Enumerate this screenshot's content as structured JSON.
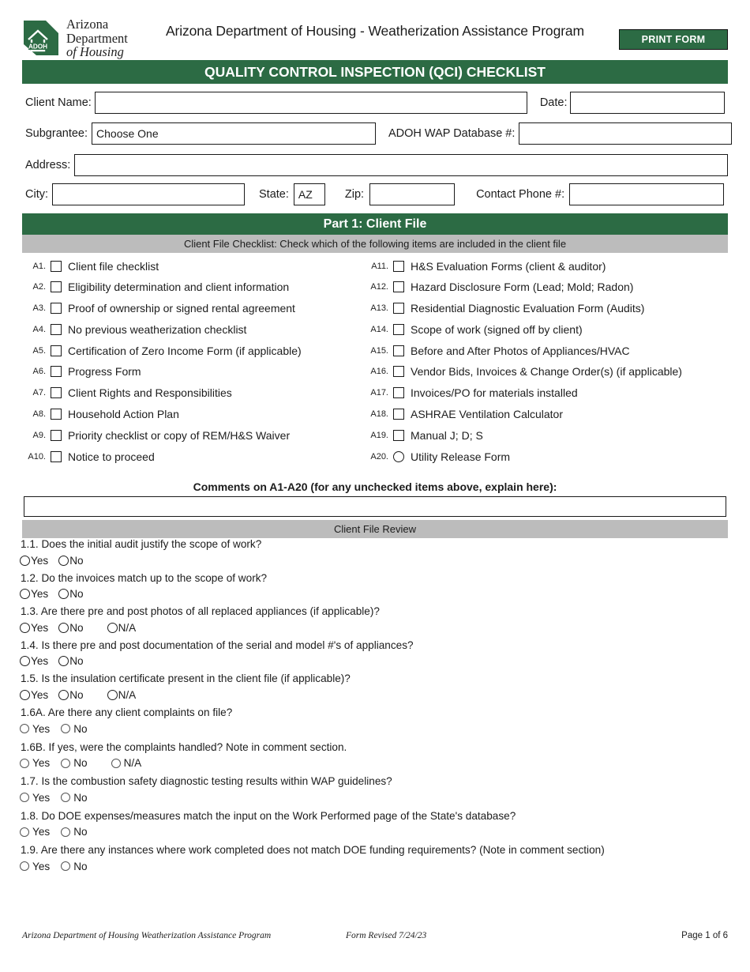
{
  "masthead": {
    "logo_line1": "Arizona",
    "logo_line2": "Department",
    "logo_line3": "of Housing",
    "logo_badge": "ADOH",
    "title": "Arizona Department of Housing - Weatherization Assistance Program",
    "print_button": "PRINT FORM"
  },
  "form_title": "QUALITY CONTROL INSPECTION (QCI) CHECKLIST",
  "fields": {
    "client_name_label": "Client Name:",
    "client_name_value": "",
    "date_label": "Date:",
    "date_value": "",
    "subgrantee_label": "Subgrantee:",
    "subgrantee_value": "Choose One",
    "adoh_db_label": "ADOH WAP Database #:",
    "adoh_db_value": "",
    "address_label": "Address:",
    "address_value": "",
    "city_label": "City:",
    "city_value": "",
    "state_label": "State:",
    "state_value": "AZ",
    "zip_label": "Zip:",
    "zip_value": "",
    "phone_label": "Contact Phone #:",
    "phone_value": ""
  },
  "part1": {
    "heading": "Part 1:  Client File",
    "checklist_instruction": "Client File Checklist: Check which of the following items are included in the client file",
    "review_heading": "Client File Review",
    "comments_heading": "Comments on A1-A20 (for any unchecked items above, explain here):",
    "comments_value": ""
  },
  "checklist_left": [
    {
      "num": "A1.",
      "label": "Client file checklist",
      "control": "checkbox"
    },
    {
      "num": "A2.",
      "label": "Eligibility determination and client information",
      "control": "checkbox"
    },
    {
      "num": "A3.",
      "label": "Proof of ownership or signed rental agreement",
      "control": "checkbox"
    },
    {
      "num": "A4.",
      "label": "No previous weatherization checklist",
      "control": "checkbox"
    },
    {
      "num": "A5.",
      "label": "Certification of Zero Income Form (if applicable)",
      "control": "checkbox"
    },
    {
      "num": "A6.",
      "label": "Progress Form",
      "control": "checkbox"
    },
    {
      "num": "A7.",
      "label": "Client Rights and Responsibilities",
      "control": "checkbox"
    },
    {
      "num": "A8.",
      "label": "Household Action Plan",
      "control": "checkbox"
    },
    {
      "num": "A9.",
      "label": "Priority checklist or copy of REM/H&S Waiver",
      "control": "checkbox"
    },
    {
      "num": "A10.",
      "label": "Notice to proceed",
      "control": "checkbox"
    }
  ],
  "checklist_right": [
    {
      "num": "A11.",
      "label": "H&S Evaluation Forms (client  & auditor)",
      "control": "checkbox"
    },
    {
      "num": "A12.",
      "label": "Hazard Disclosure Form (Lead; Mold; Radon)",
      "control": "checkbox"
    },
    {
      "num": "A13.",
      "label": "Residential Diagnostic Evaluation Form (Audits)",
      "control": "checkbox"
    },
    {
      "num": "A14.",
      "label": "Scope of work (signed off by client)",
      "control": "checkbox"
    },
    {
      "num": "A15.",
      "label": "Before and After Photos of Appliances/HVAC",
      "control": "checkbox"
    },
    {
      "num": "A16.",
      "label": "Vendor Bids, Invoices & Change Order(s) (if applicable)",
      "control": "checkbox"
    },
    {
      "num": "A17.",
      "label": "Invoices/PO for materials installed",
      "control": "checkbox"
    },
    {
      "num": "A18.",
      "label": "ASHRAE Ventilation Calculator",
      "control": "checkbox"
    },
    {
      "num": "A19.",
      "label": "Manual J; D; S",
      "control": "checkbox"
    },
    {
      "num": "A20.",
      "label": "Utility Release Form",
      "control": "radio"
    }
  ],
  "questions": [
    {
      "id": "1.1",
      "text": "1.1. Does the initial audit justify  the scope of work?",
      "options": [
        "Yes",
        "No"
      ],
      "group": "A"
    },
    {
      "id": "1.2",
      "text": "1.2. Do the invoices match up to the scope of work?",
      "options": [
        "Yes",
        "No"
      ],
      "group": "A"
    },
    {
      "id": "1.3",
      "text": "1.3. Are there pre and post photos of all replaced appliances (if applicable)?",
      "options": [
        "Yes",
        "No",
        "N/A"
      ],
      "group": "A"
    },
    {
      "id": "1.4",
      "text": "1.4. Is there pre and post documentation of the serial and model #'s of appliances?",
      "options": [
        "Yes",
        "No"
      ],
      "group": "A"
    },
    {
      "id": "1.5",
      "text": "1.5. Is the insulation certificate present in the client file (if applicable)?",
      "options": [
        "Yes",
        "No",
        "N/A"
      ],
      "group": "A"
    },
    {
      "id": "1.6A",
      "text": "1.6A. Are there any client complaints on file?",
      "options": [
        "Yes",
        "No"
      ],
      "group": "B"
    },
    {
      "id": "1.6B",
      "text": "1.6B. If yes, were the complaints handled? Note in comment section.",
      "options": [
        "Yes",
        "No",
        "N/A"
      ],
      "group": "B"
    },
    {
      "id": "1.7",
      "text": "1.7. Is the combustion safety diagnostic testing results within WAP guidelines?",
      "options": [
        "Yes",
        "No"
      ],
      "group": "B"
    },
    {
      "id": "1.8",
      "text": "1.8. Do DOE expenses/measures match the input on the Work Performed page of the State's database?",
      "options": [
        "Yes",
        "No"
      ],
      "group": "B"
    },
    {
      "id": "1.9",
      "text": "1.9. Are there any instances where work completed does not match DOE funding requirements? (Note in comment section)",
      "options": [
        "Yes",
        "No"
      ],
      "group": "B"
    }
  ],
  "footer": {
    "org": "Arizona Department of Housing Weatherization Assistance Program",
    "revision": "Form Revised 7/24/23",
    "page": "Page 1 of 6"
  },
  "colors": {
    "green": "#2c6b44",
    "gray": "#bcbcbc",
    "text": "#1c1c1c"
  }
}
